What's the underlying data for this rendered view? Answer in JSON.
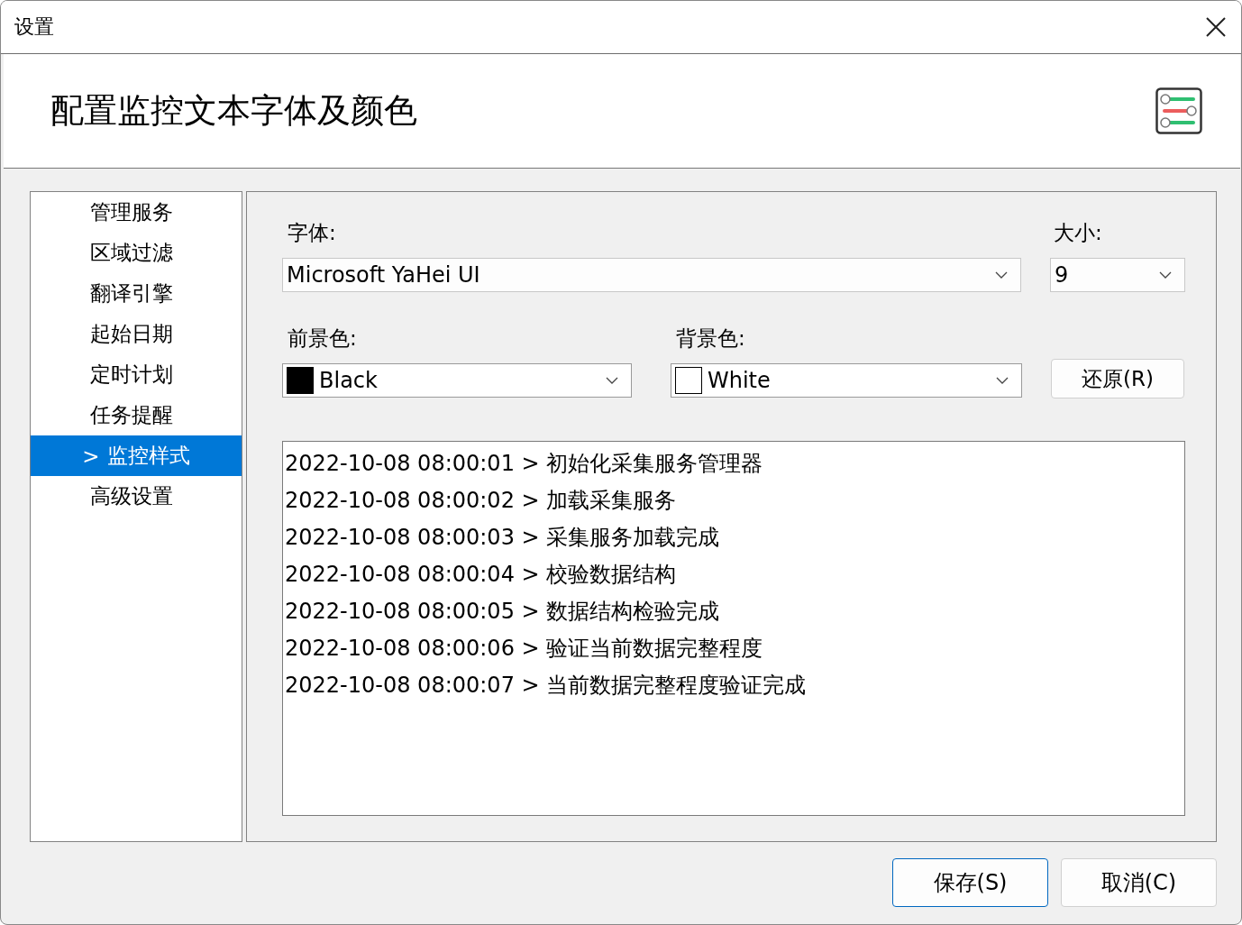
{
  "window": {
    "title": "设置"
  },
  "header": {
    "title": "配置监控文本字体及颜色"
  },
  "sidebar": {
    "items": [
      {
        "label": "管理服务",
        "selected": false
      },
      {
        "label": "区域过滤",
        "selected": false
      },
      {
        "label": "翻译引擎",
        "selected": false
      },
      {
        "label": "起始日期",
        "selected": false
      },
      {
        "label": "定时计划",
        "selected": false
      },
      {
        "label": "任务提醒",
        "selected": false
      },
      {
        "label": "监控样式",
        "selected": true,
        "prefix": ">"
      },
      {
        "label": "高级设置",
        "selected": false
      }
    ]
  },
  "font": {
    "label": "字体:",
    "value": "Microsoft YaHei UI"
  },
  "size": {
    "label": "大小:",
    "value": "9"
  },
  "foreground": {
    "label": "前景色:",
    "value": "Black",
    "color": "#000000"
  },
  "background": {
    "label": "背景色:",
    "value": "White",
    "color": "#ffffff"
  },
  "reset_button": "还原(R)",
  "preview_lines": [
    "2022-10-08 08:00:01 > 初始化采集服务管理器",
    "2022-10-08 08:00:02 > 加载采集服务",
    "2022-10-08 08:00:03 > 采集服务加载完成",
    "2022-10-08 08:00:04 > 校验数据结构",
    "2022-10-08 08:00:05 > 数据结构检验完成",
    "2022-10-08 08:00:06 > 验证当前数据完整程度",
    "2022-10-08 08:00:07 > 当前数据完整程度验证完成"
  ],
  "buttons": [
    {
      "label": "保存(S)",
      "default": true
    },
    {
      "label": "取消(C)",
      "default": false
    }
  ]
}
